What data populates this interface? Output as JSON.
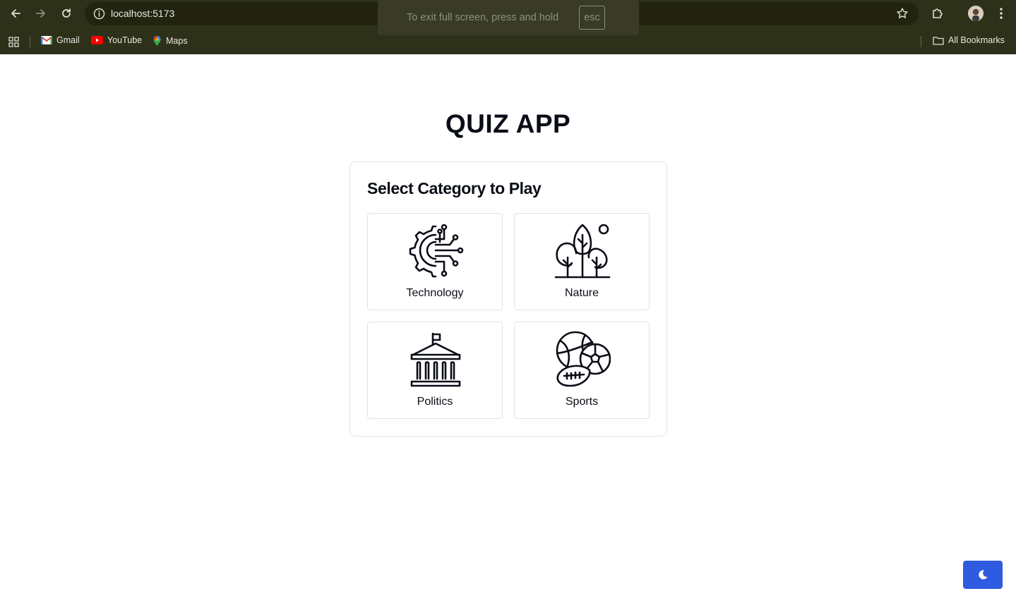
{
  "browser": {
    "url": "localhost:5173",
    "bookmarks": [
      {
        "label": "Gmail",
        "icon": "gmail-icon"
      },
      {
        "label": "YouTube",
        "icon": "youtube-icon"
      },
      {
        "label": "Maps",
        "icon": "maps-icon"
      }
    ],
    "all_bookmarks": "All Bookmarks",
    "fullscreen_toast": {
      "text": "To exit full screen, press and hold",
      "key": "esc"
    },
    "colors": {
      "chrome": "#2e3119",
      "omnibox": "#22240f"
    }
  },
  "app": {
    "title": "QUIZ APP",
    "card_title": "Select Category to Play",
    "categories": [
      {
        "label": "Technology",
        "icon": "technology-gear-circuit-icon"
      },
      {
        "label": "Nature",
        "icon": "nature-trees-icon"
      },
      {
        "label": "Politics",
        "icon": "politics-capitol-icon"
      },
      {
        "label": "Sports",
        "icon": "sports-balls-icon"
      }
    ],
    "theme_toggle_icon": "moon-icon",
    "colors": {
      "accent": "#2f5be0",
      "text": "#0a0d17",
      "border": "#e1e3e8"
    }
  }
}
